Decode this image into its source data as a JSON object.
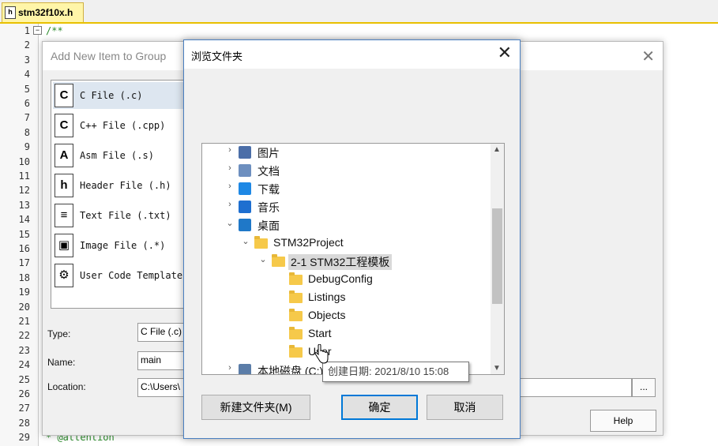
{
  "editor": {
    "tab_title": "stm32f10x.h",
    "tab_icon_glyph": "h",
    "line_numbers": [
      "1",
      "2",
      "3",
      "4",
      "5",
      "6",
      "7",
      "8",
      "9",
      "10",
      "11",
      "12",
      "13",
      "14",
      "15",
      "16",
      "17",
      "18",
      "19",
      "20",
      "21",
      "22",
      "23",
      "24",
      "25",
      "26",
      "27",
      "28",
      "29"
    ],
    "code_first_line": "/**",
    "code_last_line": "  * @attention",
    "fold_glyph": "−"
  },
  "add_dialog": {
    "title": "Add New Item to Group",
    "close_glyph": "✕",
    "items": [
      {
        "label": "C File (.c)",
        "icon": "c-file-icon",
        "glyph": "C"
      },
      {
        "label": "C++ File (.cpp)",
        "icon": "cpp-file-icon",
        "glyph": "C"
      },
      {
        "label": "Asm File (.s)",
        "icon": "asm-file-icon",
        "glyph": "A"
      },
      {
        "label": "Header File (.h)",
        "icon": "header-file-icon",
        "glyph": "h"
      },
      {
        "label": "Text File (.txt)",
        "icon": "text-file-icon",
        "glyph": "≡"
      },
      {
        "label": "Image File (.*)",
        "icon": "image-file-icon",
        "glyph": "▣"
      },
      {
        "label": "User Code Template",
        "icon": "user-code-template-icon",
        "glyph": "⚙"
      }
    ],
    "type_label": "Type:",
    "type_value": "C File (.c)",
    "name_label": "Name:",
    "name_value": "main",
    "location_label": "Location:",
    "location_value": "C:\\Users\\",
    "browse_label": "...",
    "help_label": "Help"
  },
  "browse_dialog": {
    "title": "浏览文件夹",
    "close_glyph": "✕",
    "tree": [
      {
        "label": "图片",
        "chevron": "›",
        "icon": "pictures-icon"
      },
      {
        "label": "文档",
        "chevron": "›",
        "icon": "documents-icon"
      },
      {
        "label": "下载",
        "chevron": "›",
        "icon": "downloads-icon"
      },
      {
        "label": "音乐",
        "chevron": "›",
        "icon": "music-icon"
      },
      {
        "label": "桌面",
        "chevron": "⌄",
        "icon": "desktop-icon"
      },
      {
        "label": "STM32Project",
        "chevron": "⌄",
        "icon": "folder-icon"
      },
      {
        "label": "2-1 STM32工程模板",
        "chevron": "⌄",
        "icon": "folder-icon"
      },
      {
        "label": "DebugConfig",
        "chevron": "",
        "icon": "folder-icon"
      },
      {
        "label": "Listings",
        "chevron": "",
        "icon": "folder-icon"
      },
      {
        "label": "Objects",
        "chevron": "",
        "icon": "folder-icon"
      },
      {
        "label": "Start",
        "chevron": "",
        "icon": "folder-icon"
      },
      {
        "label": "User",
        "chevron": "",
        "icon": "folder-icon"
      },
      {
        "label": "本地磁盘 (C:)",
        "chevron": "›",
        "icon": "local-disk-icon"
      }
    ],
    "tooltip": "创建日期: 2021/8/10 15:08",
    "new_folder_label": "新建文件夹(M)",
    "ok_label": "确定",
    "cancel_label": "取消",
    "scroll_up_glyph": "▲",
    "scroll_down_glyph": "▼"
  }
}
